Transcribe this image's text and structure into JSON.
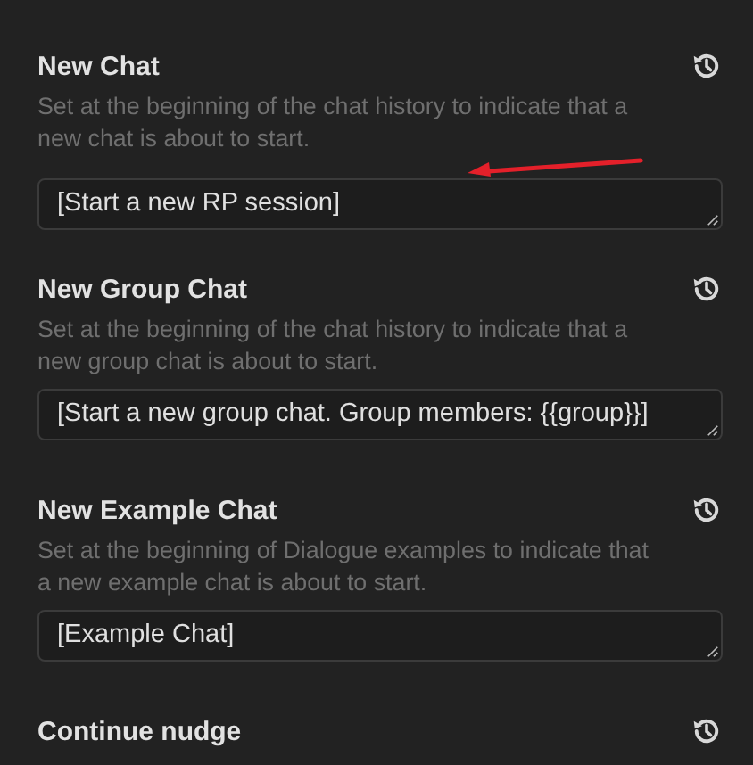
{
  "settings": [
    {
      "title": "New Chat",
      "description": "Set at the beginning of the chat history to indicate that a new chat is about to start.",
      "value": "[Start a new RP session]"
    },
    {
      "title": "New Group Chat",
      "description": "Set at the beginning of the chat history to indicate that a new group chat is about to start.",
      "value": "[Start a new group chat. Group members: {{group}}]"
    },
    {
      "title": "New Example Chat",
      "description": "Set at the beginning of Dialogue examples to indicate that a new example chat is about to start.",
      "value": "[Example Chat]"
    },
    {
      "title": "Continue nudge"
    }
  ]
}
